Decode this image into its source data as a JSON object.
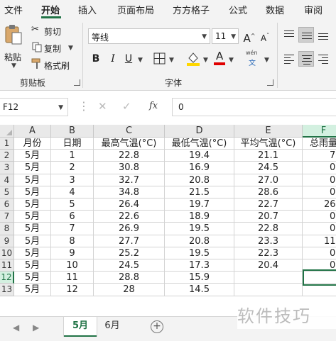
{
  "menu": {
    "items": [
      "文件",
      "开始",
      "插入",
      "页面布局",
      "方方格子",
      "公式",
      "数据",
      "审阅"
    ],
    "active": "开始"
  },
  "ribbon": {
    "clipboard": {
      "paste_label": "粘贴",
      "cut_label": "剪切",
      "copy_label": "复制",
      "format_painter_label": "格式刷",
      "group_label": "剪贴板"
    },
    "font": {
      "font_name": "等线",
      "font_size": "11",
      "grow_font": "A",
      "shrink_font": "A",
      "bold": "B",
      "italic": "I",
      "underline": "U",
      "font_color_glyph": "A",
      "phonetic_top": "wén",
      "phonetic_bottom": "文",
      "group_label": "字体"
    }
  },
  "formula_bar": {
    "name_box": "F12",
    "fx_label": "fx",
    "formula": "0"
  },
  "sheet": {
    "columns": [
      "A",
      "B",
      "C",
      "D",
      "E",
      "F"
    ],
    "headers": [
      "月份",
      "日期",
      "最高气温(°C)",
      "最低气温(°C)",
      "平均气温(°C)",
      "总雨量"
    ],
    "rows": [
      [
        "5月",
        "1",
        "22.8",
        "19.4",
        "21.1",
        "7"
      ],
      [
        "5月",
        "2",
        "30.8",
        "16.9",
        "24.5",
        "0"
      ],
      [
        "5月",
        "3",
        "32.7",
        "20.8",
        "27.0",
        "0"
      ],
      [
        "5月",
        "4",
        "34.8",
        "21.5",
        "28.6",
        "0"
      ],
      [
        "5月",
        "5",
        "26.4",
        "19.7",
        "22.7",
        "26"
      ],
      [
        "5月",
        "6",
        "22.6",
        "18.9",
        "20.7",
        "0"
      ],
      [
        "5月",
        "7",
        "26.9",
        "19.5",
        "22.8",
        "0"
      ],
      [
        "5月",
        "8",
        "27.7",
        "20.8",
        "23.3",
        "11"
      ],
      [
        "5月",
        "9",
        "25.2",
        "19.5",
        "22.3",
        "0"
      ],
      [
        "5月",
        "10",
        "24.5",
        "17.3",
        "20.4",
        "0"
      ],
      [
        "5月",
        "11",
        "28.8",
        "15.9",
        "",
        ""
      ],
      [
        "5月",
        "12",
        "28",
        "14.5",
        "",
        ""
      ]
    ],
    "row_numbers": [
      "1",
      "2",
      "3",
      "4",
      "5",
      "6",
      "7",
      "8",
      "9",
      "10",
      "11",
      "12",
      "13"
    ]
  },
  "tabs": {
    "sheets": [
      "5月",
      "6月"
    ],
    "active": "5月",
    "add_label": "+"
  },
  "watermark": "软件技巧",
  "colors": {
    "accent": "#217346",
    "highlight_yellow": "#ffd700",
    "font_red": "#e00000"
  }
}
